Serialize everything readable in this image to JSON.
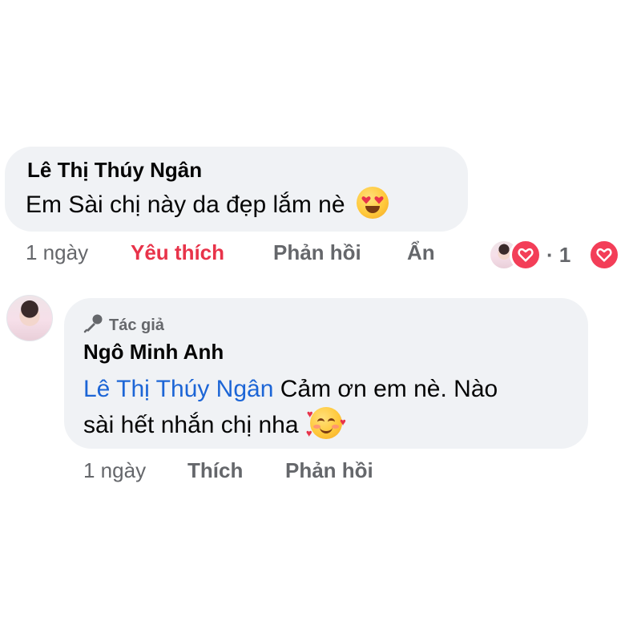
{
  "comment": {
    "author": "Lê Thị Thúy Ngân",
    "text": "Em Sài chị này da đẹp lắm nè",
    "emoji": "heart-eyes-emoji",
    "time": "1 ngày",
    "like_label": "Yêu thích",
    "reply_label": "Phản hồi",
    "hide_label": "Ẩn",
    "reactions": {
      "count_text": "· 1",
      "type": "love",
      "color": "#f33e58"
    }
  },
  "reply": {
    "badge_label": "Tác giả",
    "author": "Ngô Minh Anh",
    "mention": "Lê Thị Thúy Ngân",
    "text_line1": "Cảm ơn em nè. Nào",
    "text_line2": "sài hết nhắn chị nha",
    "emoji": "smiling-face-with-hearts-emoji",
    "time": "1 ngày",
    "like_label": "Thích",
    "reply_label": "Phản hồi"
  },
  "colors": {
    "bubble": "#f0f2f5",
    "muted_text": "#65676b",
    "mention": "#1c65d6",
    "liked": "#e8334a"
  }
}
